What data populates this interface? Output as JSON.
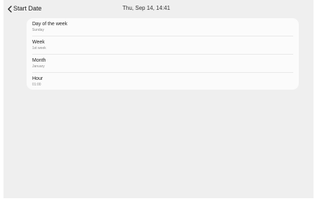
{
  "header": {
    "back_icon": "chevron-left-icon",
    "title": "Start Date",
    "clock": "Thu, Sep 14, 14:41"
  },
  "options": [
    {
      "label": "Day of the week",
      "value": "Sunday"
    },
    {
      "label": "Week",
      "value": "1st week"
    },
    {
      "label": "Month",
      "value": "January"
    },
    {
      "label": "Hour",
      "value": "01:00"
    }
  ],
  "colors": {
    "background": "#efefef",
    "card": "#fbfbfb",
    "text_primary": "#1c1c1c",
    "text_secondary": "#8a8a8a"
  }
}
